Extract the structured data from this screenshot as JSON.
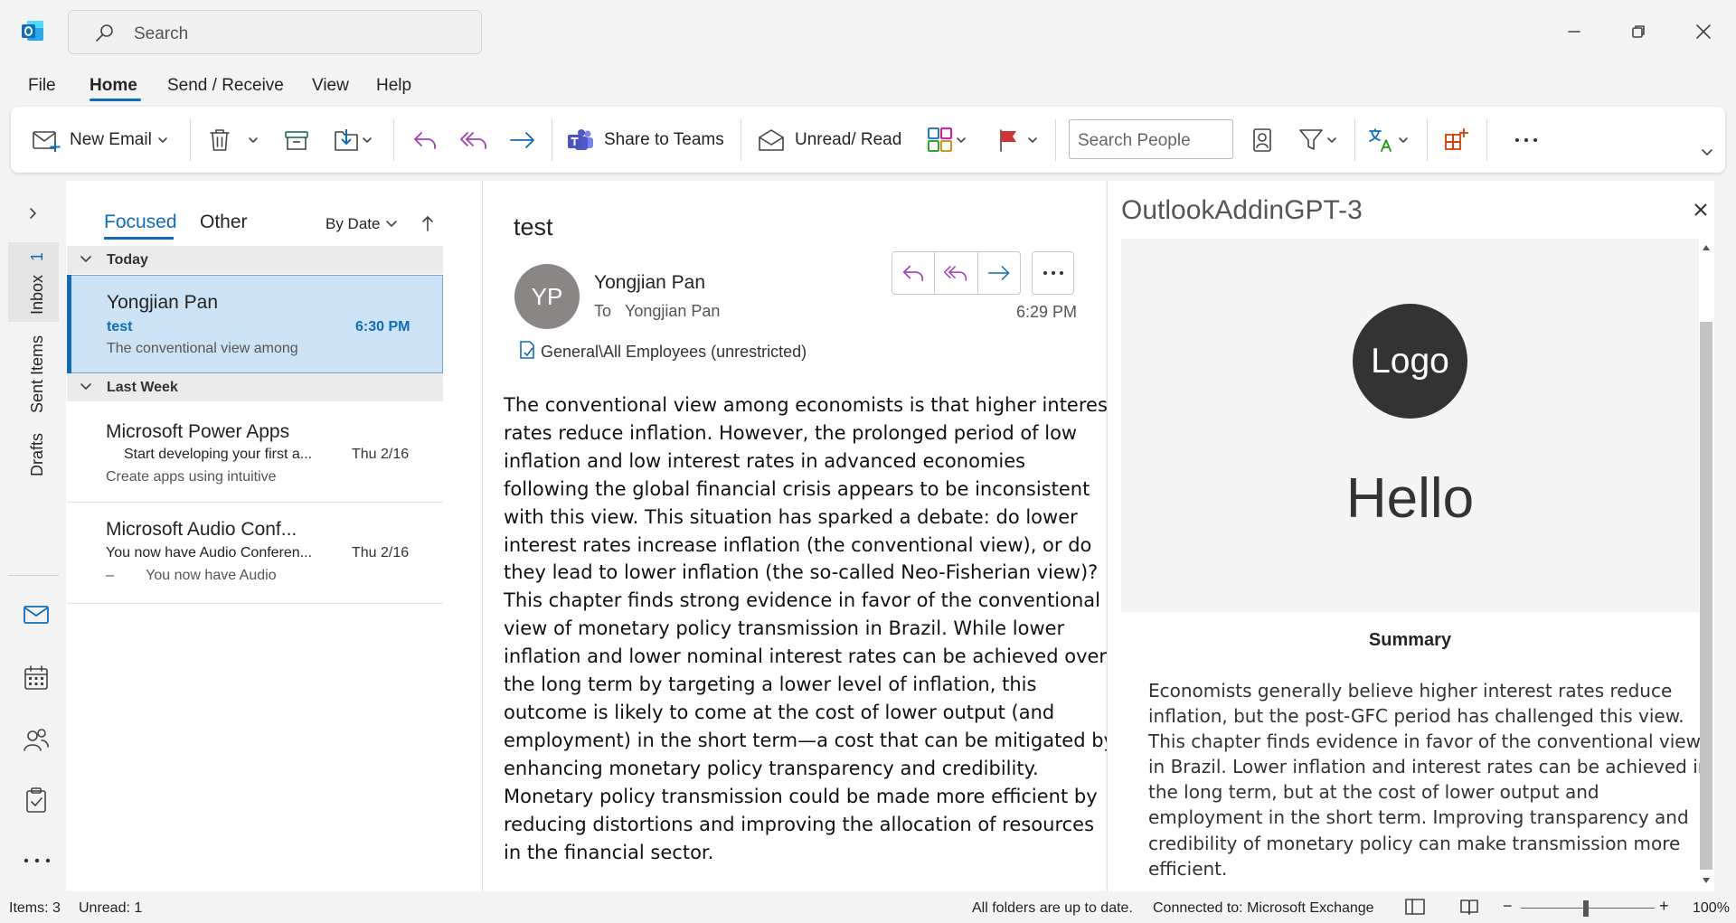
{
  "app": {
    "logo_icon": "outlook-logo-icon",
    "accent": "#0f6cbd"
  },
  "search": {
    "placeholder": "Search"
  },
  "window": {
    "minimize_icon": "minimize-icon",
    "restore_icon": "restore-icon",
    "close_icon": "close-icon"
  },
  "menu": {
    "tabs": [
      "File",
      "Home",
      "Send / Receive",
      "View",
      "Help"
    ],
    "active": "Home"
  },
  "ribbon": {
    "new_email": "New Email",
    "share_to_teams": "Share to Teams",
    "unread_read": "Unread/ Read",
    "search_people_placeholder": "Search People"
  },
  "rail": {
    "folders": [
      "Inbox",
      "Sent Items",
      "Drafts"
    ],
    "inbox_count": "1"
  },
  "mail_list": {
    "tabs": [
      "Focused",
      "Other"
    ],
    "active_tab": "Focused",
    "sort": "By Date",
    "groups": [
      {
        "label": "Today",
        "items": [
          {
            "from": "Yongjian Pan",
            "subject": "test",
            "preview": "The conventional view among",
            "date": "6:30 PM",
            "selected": true
          }
        ]
      },
      {
        "label": "Last Week",
        "items": [
          {
            "from": "Microsoft Power Apps",
            "subject": "Start developing your first a...",
            "preview": "Create apps using intuitive",
            "date": "Thu 2/16"
          },
          {
            "from": "Microsoft Audio Conf...",
            "subject": "You now have Audio Conferen...",
            "preview": "–        You now have Audio",
            "date": "Thu 2/16"
          }
        ]
      }
    ]
  },
  "reading": {
    "subject": "test",
    "avatar_initials": "YP",
    "sender": "Yongjian Pan",
    "to_label": "To",
    "to": "Yongjian Pan",
    "time": "6:29 PM",
    "sensitivity_label": "General\\All Employees (unrestricted)",
    "body_lines": [
      "The conventional view among economists is that higher interest",
      "rates reduce inflation. However, the prolonged period of low",
      "inflation and low interest rates in advanced economies",
      "following the global financial crisis appears to be inconsistent",
      "with this view. This situation has sparked a debate: do lower",
      "interest rates increase inflation (the conventional view), or do",
      "they lead to lower inflation (the so-called Neo-Fisherian view)?",
      "This chapter finds strong evidence in favor of the conventional",
      "view of monetary policy transmission in Brazil. While lower",
      "inflation and lower nominal interest rates can be achieved over",
      "the long term by targeting a lower level of inflation, this",
      "outcome is likely to come at the cost of lower output (and",
      "employment) in the short term—a cost that can be mitigated by",
      "enhancing monetary policy transparency and credibility.",
      "Monetary policy transmission could be made more efficient by",
      "reducing distortions and improving the allocation of resources",
      "in the financial sector."
    ]
  },
  "addin": {
    "title": "OutlookAddinGPT-3",
    "logo_text": "Logo",
    "hello": "Hello",
    "summary_heading": "Summary",
    "summary_lines": [
      "Economists generally believe higher interest rates reduce",
      "inflation, but the post-GFC period has challenged this view.",
      "This chapter finds evidence in favor of the conventional view",
      "in Brazil. Lower inflation and interest rates can be achieved in",
      "the long term, but at the cost of lower output and",
      "employment in the short term. Improving transparency and",
      "credibility of monetary policy can make transmission more",
      "efficient."
    ]
  },
  "status": {
    "items": "Items: 3",
    "unread": "Unread: 1",
    "sync": "All folders are up to date.",
    "connection": "Connected to: Microsoft Exchange",
    "zoom": "100%"
  }
}
